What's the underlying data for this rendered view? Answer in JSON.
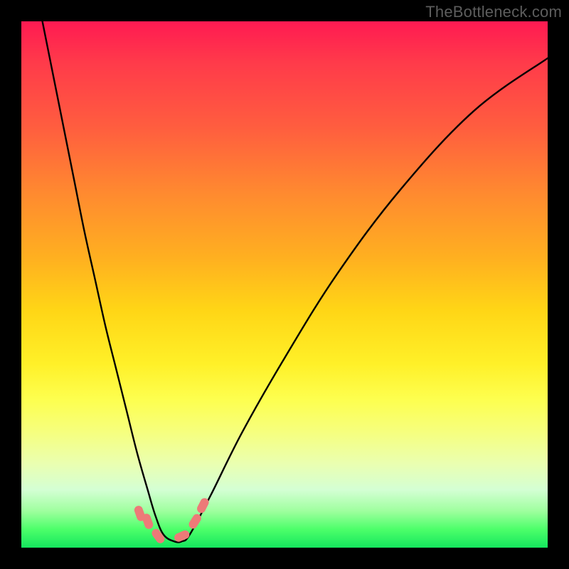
{
  "watermark": "TheBottleneck.com",
  "chart_data": {
    "type": "line",
    "title": "",
    "xlabel": "",
    "ylabel": "",
    "xlim": [
      0,
      100
    ],
    "ylim": [
      0,
      100
    ],
    "gradient_stops": [
      {
        "pct": 0,
        "color": "#ff1a52"
      },
      {
        "pct": 8,
        "color": "#ff3b4a"
      },
      {
        "pct": 20,
        "color": "#ff5d3f"
      },
      {
        "pct": 33,
        "color": "#ff8b2f"
      },
      {
        "pct": 45,
        "color": "#ffb020"
      },
      {
        "pct": 55,
        "color": "#ffd616"
      },
      {
        "pct": 65,
        "color": "#fff028"
      },
      {
        "pct": 72,
        "color": "#fdff50"
      },
      {
        "pct": 78,
        "color": "#f6ff7e"
      },
      {
        "pct": 84,
        "color": "#eaffb0"
      },
      {
        "pct": 89,
        "color": "#d4ffd4"
      },
      {
        "pct": 93,
        "color": "#9fff9f"
      },
      {
        "pct": 96.5,
        "color": "#4dff6a"
      },
      {
        "pct": 100,
        "color": "#14e75e"
      }
    ],
    "series": [
      {
        "name": "bottleneck-curve",
        "x": [
          4,
          6,
          8,
          10,
          12,
          14,
          16,
          18,
          20,
          22,
          24,
          25.5,
          27,
          29,
          30.5,
          32,
          36,
          42,
          50,
          60,
          72,
          86,
          100
        ],
        "y": [
          100,
          90,
          80,
          70,
          60,
          51,
          42,
          34,
          26,
          18,
          11,
          6,
          2.5,
          1.2,
          1.2,
          2.5,
          10,
          22,
          36,
          52,
          68,
          83,
          93
        ]
      }
    ],
    "markers": [
      {
        "x": 22.5,
        "y": 6.5,
        "color": "#ed7a78"
      },
      {
        "x": 24.0,
        "y": 5.0,
        "color": "#ed7a78"
      },
      {
        "x": 26.0,
        "y": 2.2,
        "color": "#ed7a78"
      },
      {
        "x": 30.5,
        "y": 2.2,
        "color": "#ed7a78"
      },
      {
        "x": 33.0,
        "y": 5.0,
        "color": "#ed7a78"
      },
      {
        "x": 34.5,
        "y": 8.0,
        "color": "#ed7a78"
      }
    ]
  }
}
